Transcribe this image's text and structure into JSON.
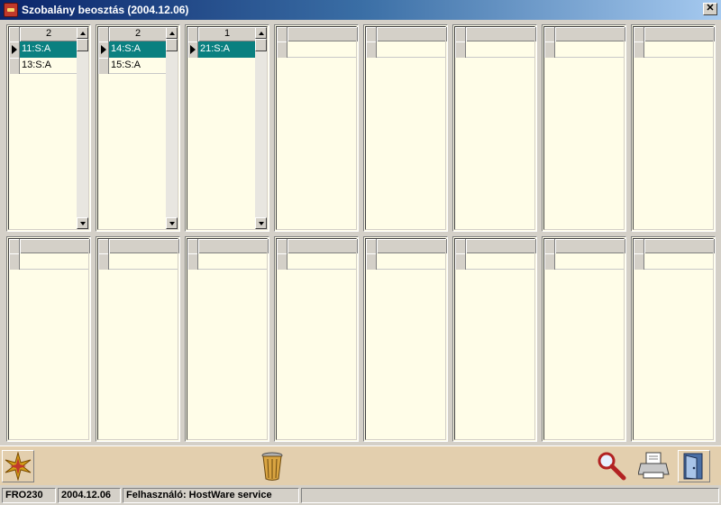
{
  "window": {
    "title": "Szobalány beosztás  (2004.12.06)",
    "close_glyph": "✕"
  },
  "panels_top": [
    {
      "header": "2",
      "rows": [
        {
          "label": "11:S:A",
          "selected": true
        },
        {
          "label": "13:S:A",
          "selected": false
        }
      ],
      "scroll": true
    },
    {
      "header": "2",
      "rows": [
        {
          "label": "14:S:A",
          "selected": true
        },
        {
          "label": "15:S:A",
          "selected": false
        }
      ],
      "scroll": true
    },
    {
      "header": "1",
      "rows": [
        {
          "label": "21:S:A",
          "selected": true
        }
      ],
      "scroll": true
    },
    {
      "header": "",
      "rows": [],
      "scroll": false
    },
    {
      "header": "",
      "rows": [],
      "scroll": false
    },
    {
      "header": "",
      "rows": [],
      "scroll": false
    },
    {
      "header": "",
      "rows": [],
      "scroll": false
    },
    {
      "header": "",
      "rows": [],
      "scroll": false
    }
  ],
  "panels_bottom": [
    {
      "header": "",
      "rows": [],
      "scroll": false
    },
    {
      "header": "",
      "rows": [],
      "scroll": false
    },
    {
      "header": "",
      "rows": [],
      "scroll": false
    },
    {
      "header": "",
      "rows": [],
      "scroll": false
    },
    {
      "header": "",
      "rows": [],
      "scroll": false
    },
    {
      "header": "",
      "rows": [],
      "scroll": false
    },
    {
      "header": "",
      "rows": [],
      "scroll": false
    },
    {
      "header": "",
      "rows": [],
      "scroll": false
    }
  ],
  "toolbar": {
    "icons": [
      "star-icon",
      "trash-icon",
      "search-icon",
      "printer-icon",
      "exit-door-icon"
    ]
  },
  "status": {
    "code": "FRO230",
    "date": "2004.12.06",
    "user": "Felhasználó: HostWare service",
    "extra": ""
  },
  "colors": {
    "selected_row": "#0a8080",
    "panel_bg": "#fffde8",
    "toolbar_bg": "#e3cfae"
  }
}
